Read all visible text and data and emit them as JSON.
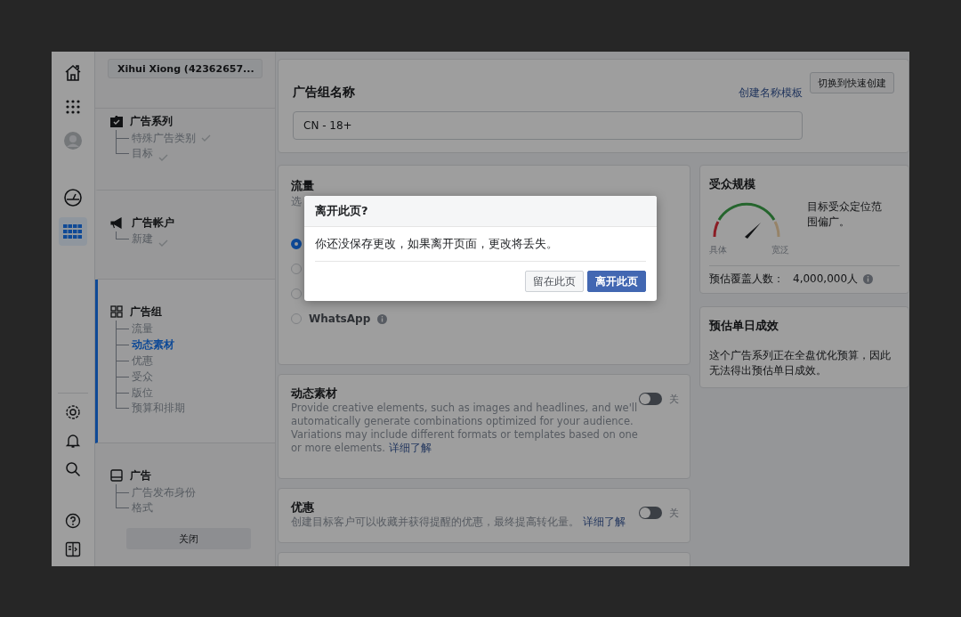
{
  "rail": {
    "top": [
      {
        "kind": "home",
        "selected": false
      },
      {
        "kind": "apps",
        "selected": false
      },
      {
        "kind": "avatar",
        "selected": false
      },
      {
        "kind": "gauge",
        "selected": false
      },
      {
        "kind": "table",
        "selected": true
      }
    ],
    "bottom": [
      {
        "kind": "settings",
        "selected": false
      },
      {
        "kind": "bell",
        "selected": false
      },
      {
        "kind": "search",
        "selected": false
      },
      {
        "kind": "help",
        "selected": false
      },
      {
        "kind": "panel",
        "selected": false
      }
    ]
  },
  "account_selector": {
    "value": "Xihui Xiong (42362657..."
  },
  "nav_sections": [
    {
      "kind": "campaign",
      "title": "广告系列",
      "active": false,
      "children": [
        {
          "label": "特殊广告类别",
          "done": true,
          "selected": false
        },
        {
          "label": "目标",
          "done": true,
          "selected": false
        }
      ]
    },
    {
      "kind": "account",
      "title": "广告帐户",
      "active": false,
      "children": [
        {
          "label": "新建",
          "done": true,
          "selected": false
        }
      ]
    },
    {
      "kind": "adset",
      "title": "广告组",
      "active": true,
      "children": [
        {
          "label": "流量",
          "done": false,
          "selected": false
        },
        {
          "label": "动态素材",
          "done": false,
          "selected": true
        },
        {
          "label": "优惠",
          "done": false,
          "selected": false
        },
        {
          "label": "受众",
          "done": false,
          "selected": false
        },
        {
          "label": "版位",
          "done": false,
          "selected": false
        },
        {
          "label": "预算和排期",
          "done": false,
          "selected": false
        }
      ]
    },
    {
      "kind": "ad",
      "title": "广告",
      "active": false,
      "children": [
        {
          "label": "广告发布身份",
          "done": false,
          "selected": false
        },
        {
          "label": "格式",
          "done": false,
          "selected": false
        }
      ]
    }
  ],
  "close_button": "关闭",
  "name_card": {
    "title": "广告组名称",
    "link": "创建名称模板",
    "value": "CN - 18+",
    "switch_button": "切换到快速创建"
  },
  "traffic": {
    "title": "流量",
    "subtitle": "选",
    "options": [
      {
        "selected": true
      },
      {
        "selected": false
      },
      {
        "selected": false
      },
      {
        "label": "WhatsApp",
        "selected": false
      }
    ]
  },
  "features": [
    {
      "title": "动态素材",
      "text": "Provide creative elements, such as images and headlines, and we'll automatically generate combinations optimized for your audience. Variations may include different formats or templates based on one or more elements.",
      "link": "详细了解",
      "on": false,
      "state_label": "关"
    },
    {
      "title": "优惠",
      "text": "创建目标客户可以收藏并获得提醒的优惠，最终提高转化量。",
      "link": "详细了解",
      "on": false,
      "state_label": "关"
    }
  ],
  "audience": {
    "title": "受众规模",
    "gauge_labels": [
      "具体",
      "宽泛"
    ],
    "note": "目标受众定位范围偏广。",
    "estimate_label": "预估覆盖人数：",
    "estimate_value": "4,000,000人"
  },
  "daily": {
    "title": "预估单日成效",
    "text": "这个广告系列正在全盘优化预算，因此无法得出预估单日成效。"
  },
  "dialog": {
    "title": "离开此页?",
    "message": "你还没保存更改，如果离开页面，更改将丢失。",
    "buttons": [
      {
        "label": "留在此页",
        "kind": "secondary"
      },
      {
        "label": "离开此页",
        "kind": "primary"
      }
    ]
  }
}
